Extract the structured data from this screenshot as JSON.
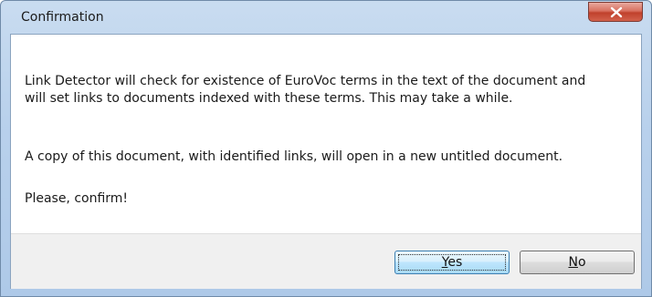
{
  "window": {
    "title": "Confirmation"
  },
  "message": {
    "line1": "Link Detector will check for existence of EuroVoc terms in the text of the document and will set links to documents indexed with these terms. This may take a while.",
    "line2": "A copy of this document, with identified links, will open in a new untitled document.",
    "line3": "Please, confirm!"
  },
  "buttons": {
    "yes_accel": "Y",
    "yes_rest": "es",
    "no_accel": "N",
    "no_rest": "o"
  },
  "icons": {
    "close": "close-icon"
  },
  "colors": {
    "close_button": "#c0412c",
    "default_button_border": "#3c7fb1",
    "button_area": "#f0f0f0"
  }
}
